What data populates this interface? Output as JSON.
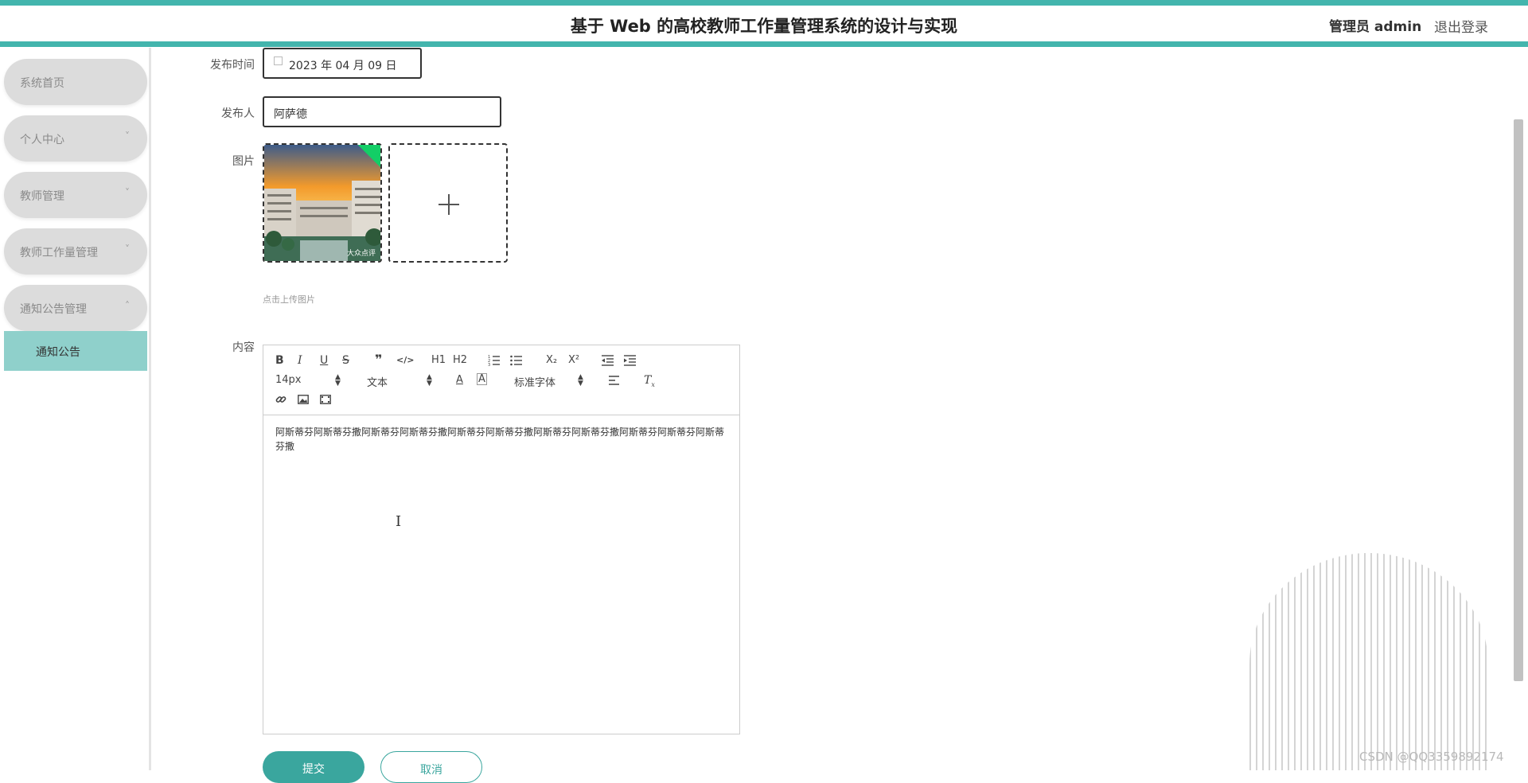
{
  "header": {
    "title": "基于 Web 的高校教师工作量管理系统的设计与实现",
    "user": "管理员 admin",
    "logout": "退出登录",
    "accent": "#43b5ad"
  },
  "sidebar": {
    "items": [
      {
        "label": "系统首页",
        "chevron": ""
      },
      {
        "label": "个人中心",
        "chevron": "˅"
      },
      {
        "label": "教师管理",
        "chevron": "˅"
      },
      {
        "label": "教师工作量管理",
        "chevron": "˅"
      },
      {
        "label": "通知公告管理",
        "chevron": "˄"
      }
    ],
    "subitem": "通知公告",
    "active_color": "#8fd0cb"
  },
  "form": {
    "publish_time_label": "发布时间",
    "publish_time_value": "2023 年 04 月 09 日",
    "publisher_label": "发布人",
    "publisher_value": "阿萨德",
    "image_label": "图片",
    "image_watermark": "大众点评",
    "upload_hint": "点击上传图片",
    "content_label": "内容",
    "submit": "提交",
    "cancel": "取消"
  },
  "editor": {
    "toolbar_row1": [
      "B",
      "I",
      "U",
      "S",
      "❞",
      "</>",
      "H1",
      "H2",
      "ol",
      "ul",
      "X₂",
      "X²",
      "outdent",
      "indent"
    ],
    "size": "14px",
    "header_select": "文本",
    "font_select": "标准字体",
    "icons": [
      "link-icon",
      "image-icon",
      "video-icon",
      "color-icon",
      "background-icon",
      "align-icon",
      "clean-icon"
    ],
    "content": "阿斯蒂芬阿斯蒂芬撒阿斯蒂芬阿斯蒂芬撒阿斯蒂芬阿斯蒂芬撒阿斯蒂芬阿斯蒂芬撒阿斯蒂芬阿斯蒂芬阿斯蒂芬撒"
  },
  "watermark": "CSDN @QQ3359892174"
}
